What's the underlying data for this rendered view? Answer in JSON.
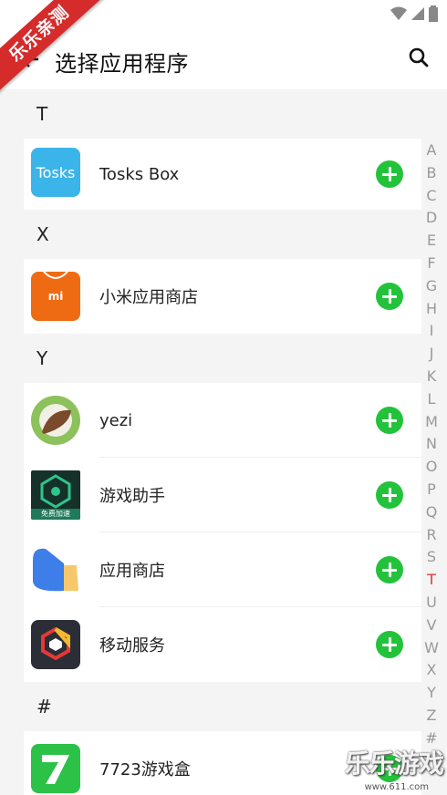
{
  "watermark": {
    "ribbon_text": "乐乐亲测",
    "corner_text": "乐乐游戏",
    "corner_url": "www.611.com"
  },
  "header": {
    "title": "选择应用程序"
  },
  "icons": {
    "back": "back-arrow-icon",
    "search": "search-icon",
    "add": "add-icon"
  },
  "colors": {
    "accent_green": "#22c33a",
    "active_index": "#e53935"
  },
  "sections": [
    {
      "letter": "T",
      "apps": [
        {
          "name": "Tosks Box",
          "icon_text": "Tosks"
        }
      ]
    },
    {
      "letter": "X",
      "apps": [
        {
          "name": "小米应用商店",
          "icon_text": "mi"
        }
      ]
    },
    {
      "letter": "Y",
      "apps": [
        {
          "name": "yezi",
          "icon_text": ""
        },
        {
          "name": "游戏助手",
          "icon_text": "免费加速"
        },
        {
          "name": "应用商店",
          "icon_text": ""
        },
        {
          "name": "移动服务",
          "icon_text": ""
        }
      ]
    },
    {
      "letter": "#",
      "apps": [
        {
          "name": "7723游戏盒",
          "icon_text": ""
        }
      ]
    }
  ],
  "index_bar": [
    "A",
    "B",
    "C",
    "D",
    "E",
    "F",
    "G",
    "H",
    "I",
    "J",
    "K",
    "L",
    "M",
    "N",
    "O",
    "P",
    "Q",
    "R",
    "S",
    "T",
    "U",
    "V",
    "W",
    "X",
    "Y",
    "Z",
    "#"
  ],
  "index_active": "T"
}
